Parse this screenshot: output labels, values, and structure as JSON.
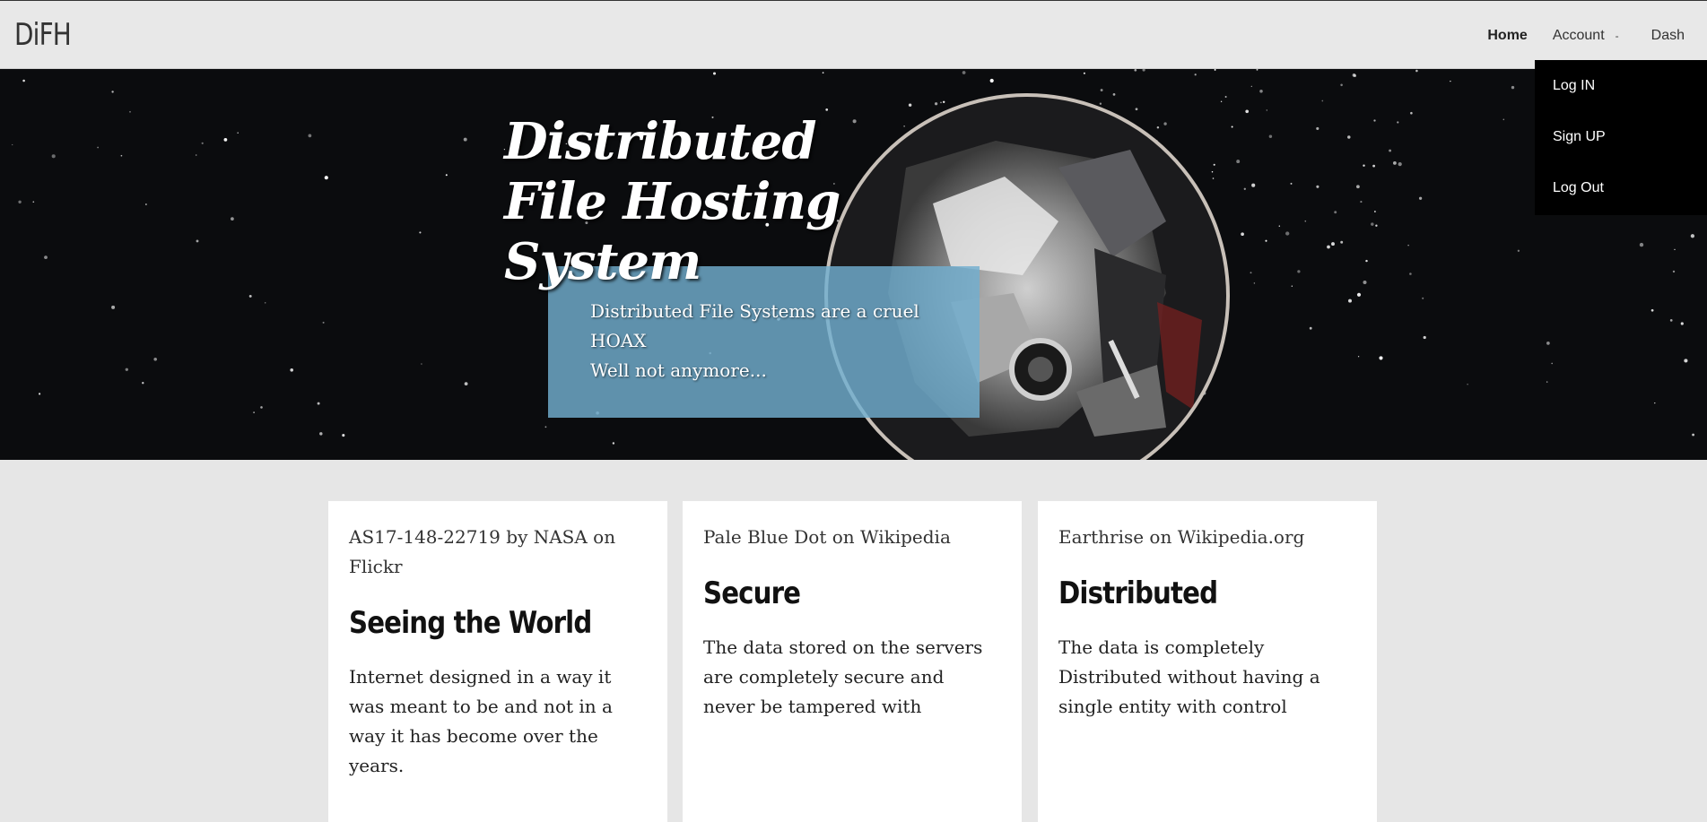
{
  "nav": {
    "brand": "DiFH",
    "home": "Home",
    "account": "Account",
    "caret": "-",
    "dash": "Dash",
    "dropdown": [
      "Log IN",
      "Sign UP",
      "Log Out"
    ]
  },
  "hero": {
    "title_lines": [
      "Distributed",
      "File Hosting",
      "System"
    ],
    "box_lines": [
      "Distributed File Systems are a cruel",
      "HOAX",
      "Well not anymore..."
    ]
  },
  "cards": [
    {
      "img_alt": "AS17-148-22719 by NASA on Flickr",
      "title": "Seeing the World",
      "text": "Internet designed in a way it was meant to be and not in a way it has become over the years."
    },
    {
      "img_alt": "Pale Blue Dot on Wikipedia",
      "title": "Secure",
      "text": "The data stored on the servers are completely secure and never be tampered with"
    },
    {
      "img_alt": "Earthrise on Wikipedia.org",
      "title": "Distributed",
      "text": "The data is completely Distributed without having a single entity with control"
    }
  ],
  "colors": {
    "navbar_bg": "#e8e8e8",
    "dropdown_bg": "#000000",
    "hero_box": "#71afd0",
    "page_bg": "#e6e6e6",
    "card_bg": "#ffffff"
  }
}
